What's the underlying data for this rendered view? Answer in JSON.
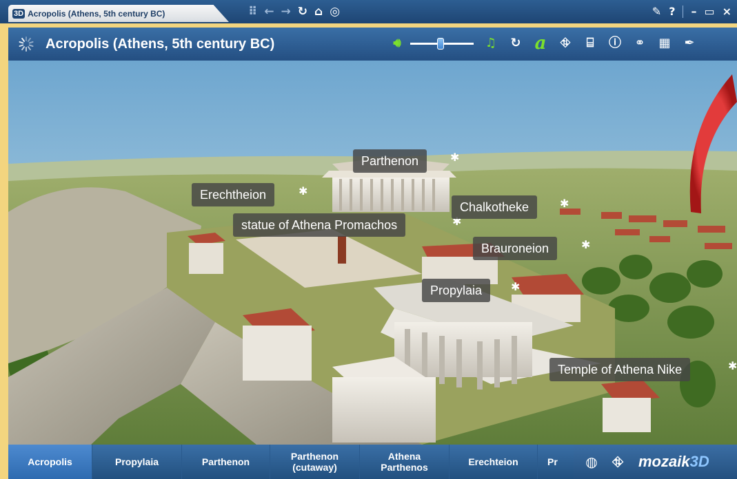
{
  "window": {
    "tab_logo": "3D",
    "tab_title": "Acropolis (Athens, 5th century BC)",
    "nav_icons": [
      "grid-icon",
      "back-arrow-icon",
      "forward-arrow-icon",
      "reload-icon",
      "home-icon",
      "compass-icon"
    ],
    "controls": [
      "pin-icon",
      "help-icon",
      "minimize-icon",
      "maximize-icon",
      "close-icon"
    ]
  },
  "titlebar": {
    "title": "Acropolis (Athens, 5th century BC)",
    "volume_level": 0.48,
    "tools": [
      "speaker-icon",
      "music-icon",
      "replay-icon",
      "font-icon",
      "walk-icon",
      "camera-icon",
      "info-icon",
      "link-icon",
      "apps-icon",
      "settings-icon"
    ]
  },
  "labels": [
    {
      "text": "Parthenon"
    },
    {
      "text": "Erechtheion"
    },
    {
      "text": "statue of Athena Promachos"
    },
    {
      "text": "Chalkotheke"
    },
    {
      "text": "Brauroneion"
    },
    {
      "text": "Propylaia"
    },
    {
      "text": "Temple of Athena Nike"
    }
  ],
  "bottom_nav": [
    {
      "label": "Acropolis",
      "active": true
    },
    {
      "label": "Propylaia",
      "active": false
    },
    {
      "label": "Parthenon",
      "active": false
    },
    {
      "label": "Parthenon\n(cutaway)",
      "active": false
    },
    {
      "label": "Athena\nParthenos",
      "active": false
    },
    {
      "label": "Erechteion",
      "active": false
    },
    {
      "label": "Pr",
      "active": false
    }
  ],
  "brand": {
    "name": "mozaik",
    "suffix": "3D"
  },
  "colors": {
    "frame": "#f3d57f",
    "bar": "#2a5a8d",
    "active_tab": "#3f7ec6",
    "label_bg": "#464646",
    "accent_green": "#7be02c"
  }
}
